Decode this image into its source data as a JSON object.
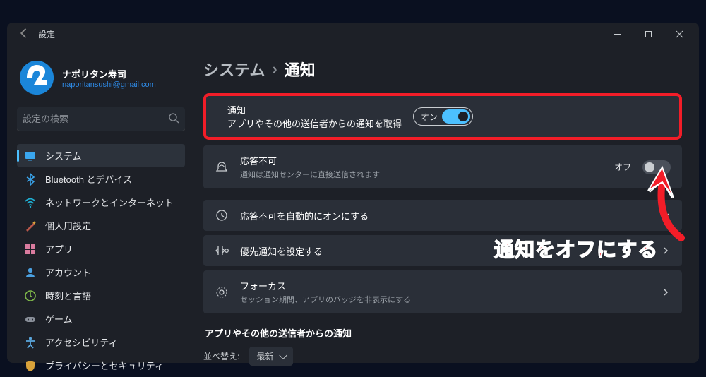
{
  "window": {
    "app_title": "設定"
  },
  "user": {
    "name": "ナポリタン寿司",
    "email": "naporitansushi@gmail.com"
  },
  "search": {
    "placeholder": "設定の検索"
  },
  "sidebar": {
    "items": [
      {
        "label": "システム",
        "icon": "system",
        "color": "#3aa6ee",
        "selected": true
      },
      {
        "label": "Bluetooth とデバイス",
        "icon": "bluetooth",
        "color": "#3aa6ee"
      },
      {
        "label": "ネットワークとインターネット",
        "icon": "network",
        "color": "#1fb0d4"
      },
      {
        "label": "個人用設定",
        "icon": "personalization",
        "color": "#b8574a"
      },
      {
        "label": "アプリ",
        "icon": "apps",
        "color": "#d97b9e"
      },
      {
        "label": "アカウント",
        "icon": "account",
        "color": "#4aa0e0"
      },
      {
        "label": "時刻と言語",
        "icon": "time-language",
        "color": "#7fb84a"
      },
      {
        "label": "ゲーム",
        "icon": "gaming",
        "color": "#8a909a"
      },
      {
        "label": "アクセシビリティ",
        "icon": "accessibility",
        "color": "#5aa7de"
      },
      {
        "label": "プライバシーとセキュリティ",
        "icon": "privacy",
        "color": "#d9a23a"
      }
    ]
  },
  "breadcrumb": {
    "parent": "システム",
    "current": "通知"
  },
  "cards": {
    "notifications": {
      "title": "通知",
      "sub": "アプリやその他の送信者からの通知を取得",
      "state_label": "オン",
      "state": true
    },
    "dnd": {
      "title": "応答不可",
      "sub": "通知は通知センターに直接送信されます",
      "state_label": "オフ",
      "state": false
    },
    "auto_dnd": {
      "title": "応答不可を自動的にオンにする"
    },
    "priority": {
      "title": "優先通知を設定する"
    },
    "focus": {
      "title": "フォーカス",
      "sub": "セッション期間、アプリのバッジを非表示にする"
    }
  },
  "sender_section": {
    "heading": "アプリやその他の送信者からの通知",
    "sort_label": "並べ替え:",
    "sort_value": "最新"
  },
  "annotation": {
    "text": "通知をオフにする"
  }
}
